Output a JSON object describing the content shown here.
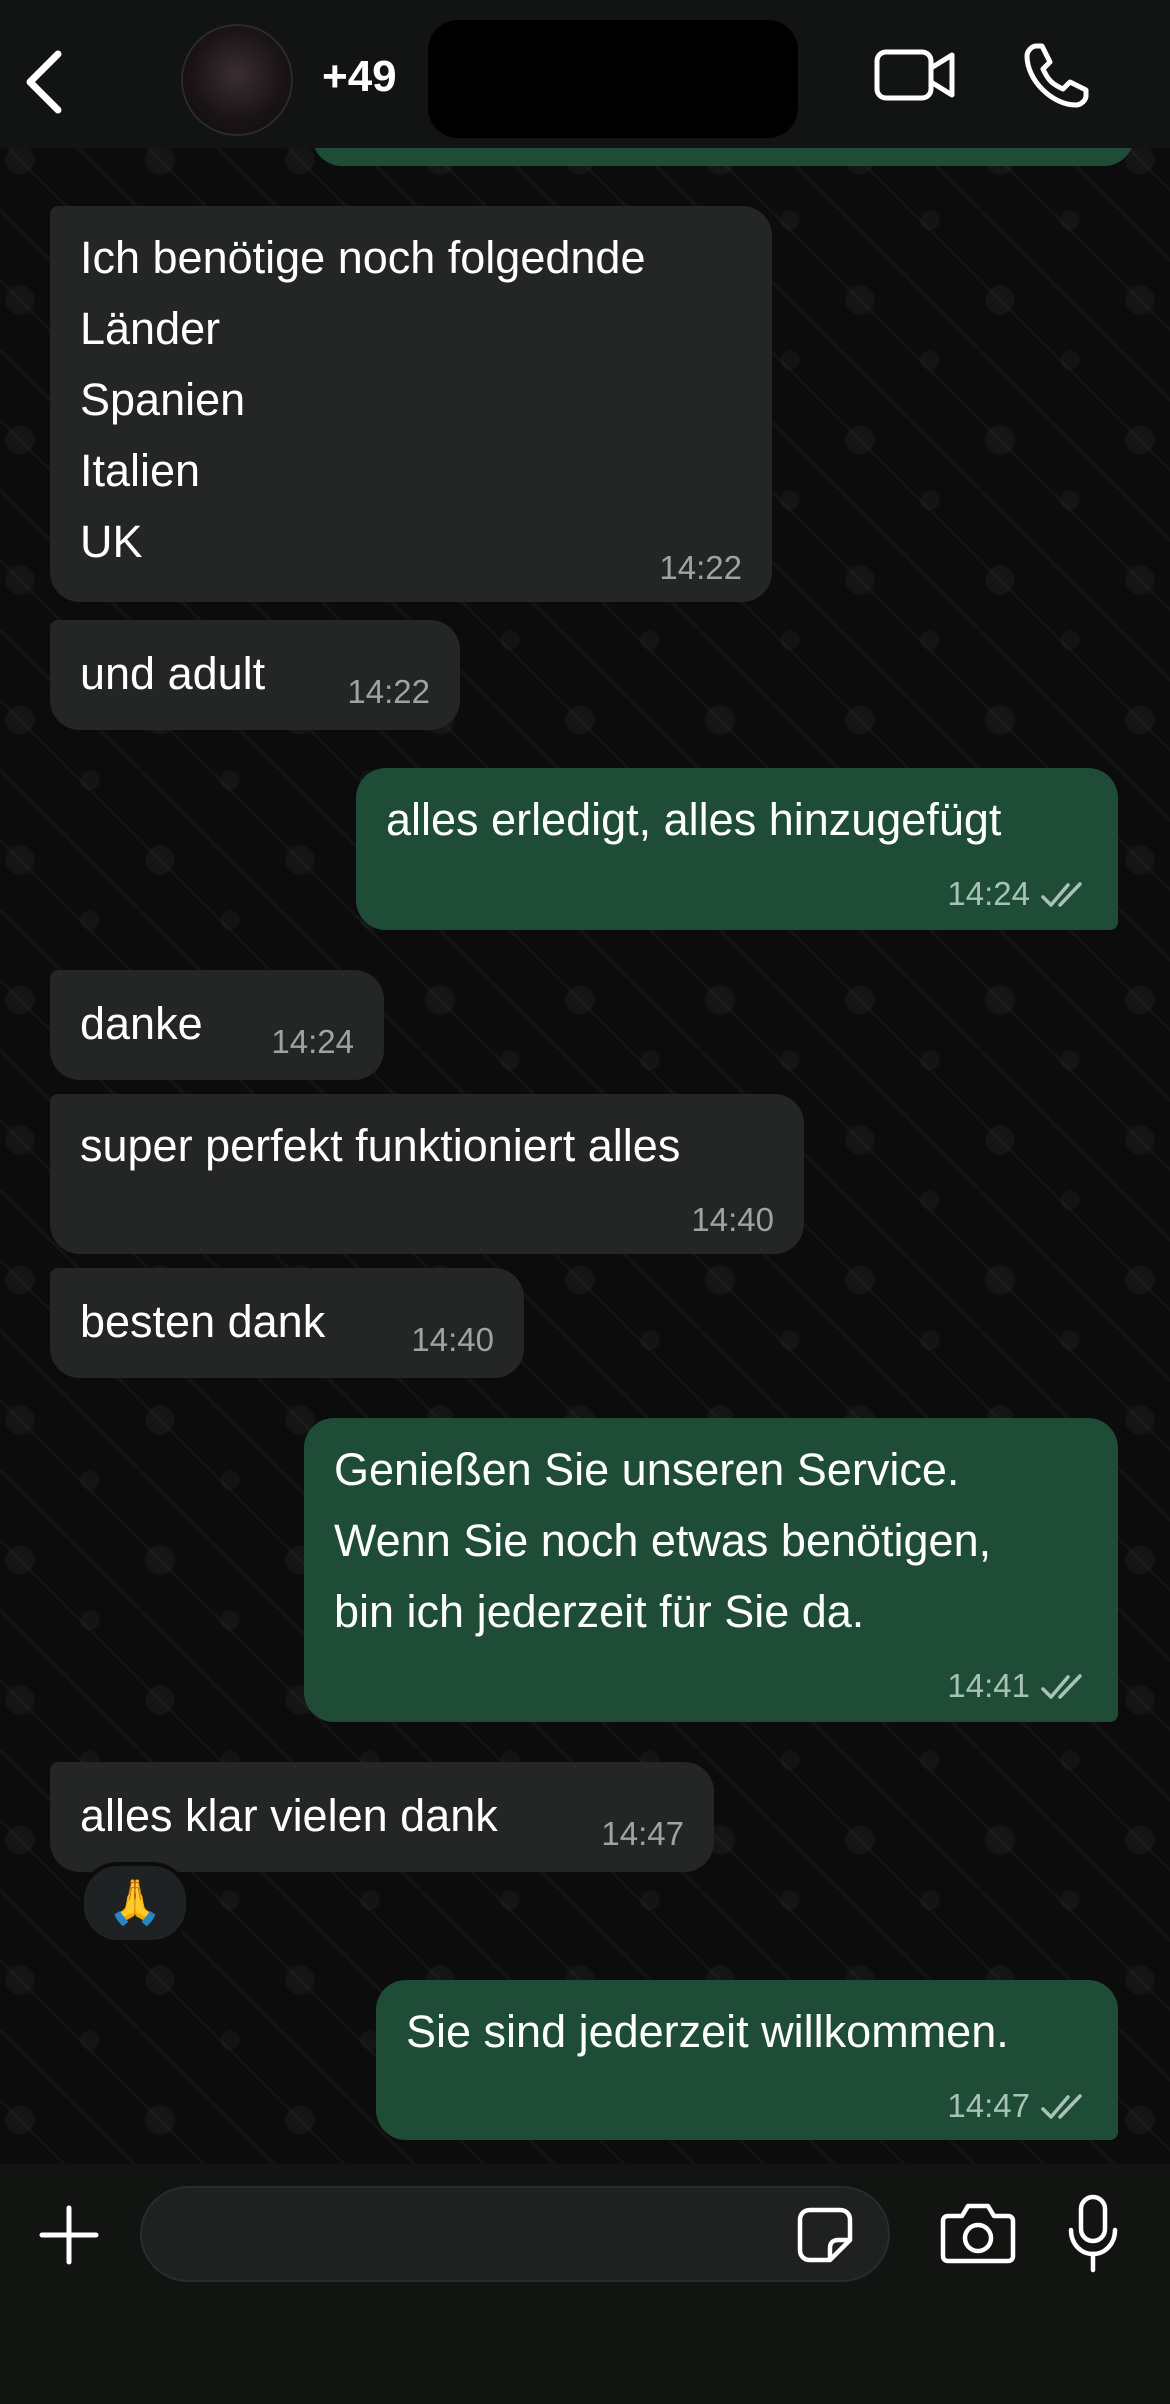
{
  "header": {
    "contact_name": "+49",
    "icons": {
      "back": "chevron-left-icon",
      "video": "video-camera-icon",
      "call": "phone-icon"
    }
  },
  "messages": [
    {
      "direction": "incoming",
      "lines": "Ich benötige noch folgednde\nLänder\nSpanien\nItalien\nUK",
      "time": "14:22"
    },
    {
      "direction": "incoming",
      "lines": "und adult",
      "time": "14:22"
    },
    {
      "direction": "outgoing",
      "lines": "alles erledigt, alles hinzugefügt",
      "time": "14:24",
      "status": "read"
    },
    {
      "direction": "incoming",
      "lines": "danke",
      "time": "14:24"
    },
    {
      "direction": "incoming",
      "lines": "super perfekt funktioniert alles",
      "time": "14:40"
    },
    {
      "direction": "incoming",
      "lines": "besten dank",
      "time": "14:40"
    },
    {
      "direction": "outgoing",
      "lines": "Genießen Sie unseren Service.\nWenn Sie noch etwas benötigen,\nbin ich jederzeit für Sie da.",
      "time": "14:41",
      "status": "read"
    },
    {
      "direction": "incoming",
      "lines": "alles klar vielen dank",
      "time": "14:47",
      "reaction": "🙏"
    },
    {
      "direction": "outgoing",
      "lines": "Sie sind jederzeit willkommen.",
      "time": "14:47",
      "status": "read"
    }
  ],
  "composer": {
    "input_value": "",
    "icons": {
      "add": "plus-icon",
      "sticker": "sticker-icon",
      "camera": "camera-icon",
      "mic": "microphone-icon"
    }
  },
  "colors": {
    "incoming_bubble": "#242626",
    "outgoing_bubble": "#1f4c37",
    "background": "#0b0b0b",
    "read_ticks": "#a8c3b5"
  }
}
